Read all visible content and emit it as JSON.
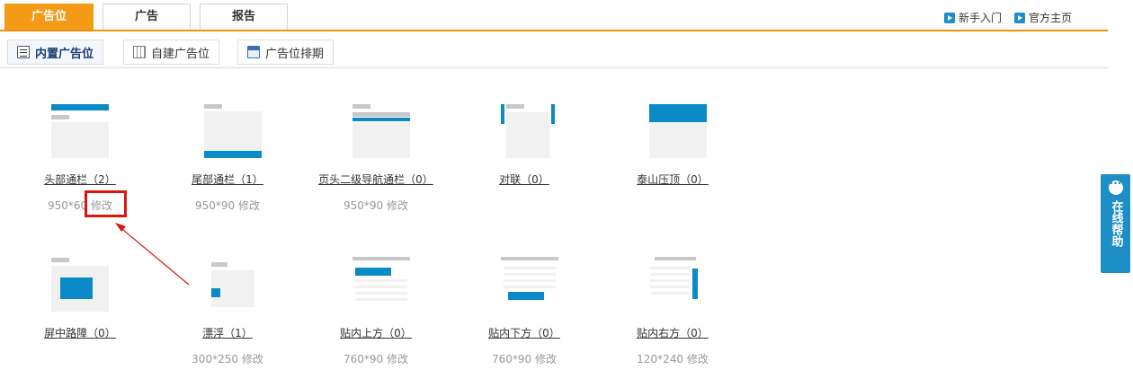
{
  "top_tabs": [
    {
      "label": "广告位",
      "active": true
    },
    {
      "label": "广告",
      "active": false
    },
    {
      "label": "报告",
      "active": false
    }
  ],
  "top_links": [
    {
      "label": "新手入门",
      "icon": "play-icon"
    },
    {
      "label": "官方主页",
      "icon": "play-icon"
    }
  ],
  "sub_tabs": [
    {
      "label": "内置广告位",
      "icon": "list-icon",
      "active": true
    },
    {
      "label": "自建广告位",
      "icon": "grid-icon",
      "active": false
    },
    {
      "label": "广告位排期",
      "icon": "calendar-icon",
      "active": false
    }
  ],
  "slots_row1": [
    {
      "name": "头部通栏（2）",
      "size": "950*60",
      "action": "修改"
    },
    {
      "name": "尾部通栏（1）",
      "size": "950*90",
      "action": "修改"
    },
    {
      "name": "页头二级导航通栏（0）",
      "size": "950*90",
      "action": "修改"
    },
    {
      "name": "对联（0）",
      "size": "",
      "action": ""
    },
    {
      "name": "泰山压顶（0）",
      "size": "",
      "action": ""
    }
  ],
  "slots_row2": [
    {
      "name": "屏中路障（0）",
      "size": "",
      "action": ""
    },
    {
      "name": "漂浮（1）",
      "size": "300*250",
      "action": "修改"
    },
    {
      "name": "贴内上方（0）",
      "size": "760*90",
      "action": "修改"
    },
    {
      "name": "贴内下方（0）",
      "size": "760*90",
      "action": "修改"
    },
    {
      "name": "贴内右方（0）",
      "size": "120*240",
      "action": "修改"
    }
  ],
  "help": {
    "label": "在线帮助"
  },
  "colors": {
    "accent": "#f39a16",
    "blue": "#0a8ac7",
    "highlight": "#d9160f"
  }
}
